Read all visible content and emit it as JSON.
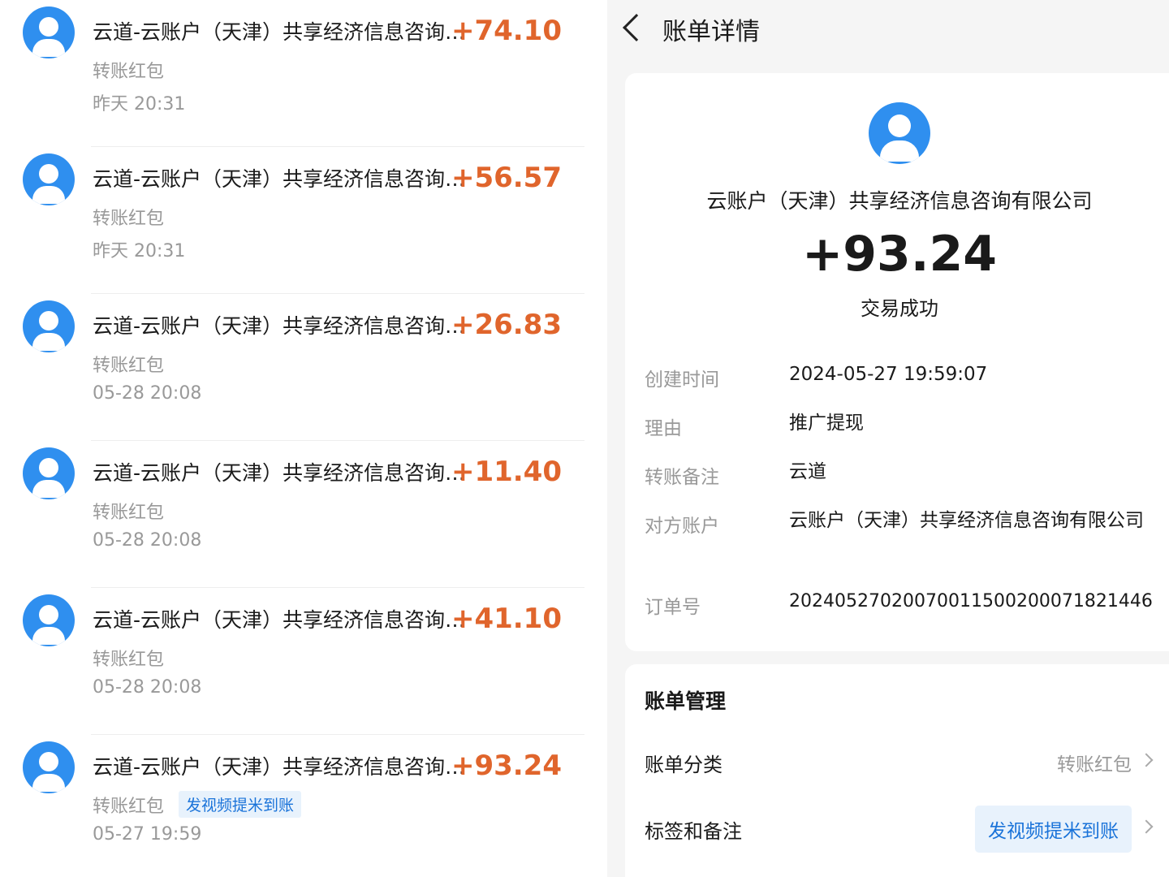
{
  "transactions": [
    {
      "title": "云道-云账户（天津）共享经济信息咨询有限公司",
      "amount": "+74.10",
      "subtitle": "转账红包",
      "time": "昨天 20:31",
      "tag": ""
    },
    {
      "title": "云道-云账户（天津）共享经济信息咨询有限公司",
      "amount": "+56.57",
      "subtitle": "转账红包",
      "time": "昨天 20:31",
      "tag": ""
    },
    {
      "title": "云道-云账户（天津）共享经济信息咨询有限公司",
      "amount": "+26.83",
      "subtitle": "转账红包",
      "time": "05-28 20:08",
      "tag": ""
    },
    {
      "title": "云道-云账户（天津）共享经济信息咨询有限公司",
      "amount": "+11.40",
      "subtitle": "转账红包",
      "time": "05-28 20:08",
      "tag": ""
    },
    {
      "title": "云道-云账户（天津）共享经济信息咨询有限公司",
      "amount": "+41.10",
      "subtitle": "转账红包",
      "time": "05-28 20:08",
      "tag": ""
    },
    {
      "title": "云道-云账户（天津）共享经济信息咨询有限公司",
      "amount": "+93.24",
      "subtitle": "转账红包",
      "time": "05-27 19:59",
      "tag": "发视频提米到账"
    }
  ],
  "detail": {
    "page_title": "账单详情",
    "company": "云账户（天津）共享经济信息咨询有限公司",
    "amount": "+93.24",
    "status": "交易成功",
    "rows": [
      {
        "label": "创建时间",
        "value": "2024-05-27 19:59:07"
      },
      {
        "label": "理由",
        "value": "推广提现"
      },
      {
        "label": "转账备注",
        "value": "云道"
      },
      {
        "label": "对方账户",
        "value": "云账户（天津）共享经济信息咨询有限公司"
      },
      {
        "label": "订单号",
        "value": "20240527020070011500200071821446"
      }
    ]
  },
  "management": {
    "section_title": "账单管理",
    "category_label": "账单分类",
    "category_value": "转账红包",
    "tags_label": "标签和备注",
    "tags_value": "发视频提米到账"
  },
  "colors": {
    "accent_blue": "#2f8fef",
    "amount_orange": "#e0652c",
    "tag_blue": "#1a73d9"
  }
}
